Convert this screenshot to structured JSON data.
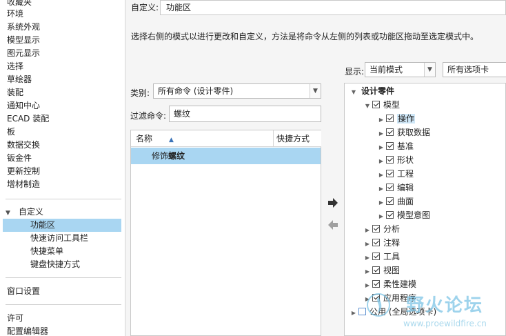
{
  "left_nav": {
    "items": [
      "收藏夹",
      "环境",
      "系统外观",
      "模型显示",
      "图元显示",
      "选择",
      "草绘器",
      "装配",
      "通知中心",
      "ECAD 装配",
      "板",
      "数据交换",
      "钣金件",
      "更新控制",
      "增材制造"
    ],
    "custom_group": "自定义",
    "custom_items": [
      "功能区",
      "快速访问工具栏",
      "快捷菜单",
      "键盘快捷方式"
    ],
    "window_settings": "窗口设置",
    "tail_items": [
      "许可",
      "配置编辑器"
    ]
  },
  "header": {
    "custom_label": "自定义:",
    "custom_value": "功能区",
    "instruction": "选择右侧的模式以进行更改和自定义，方法是将命令从左侧的列表或功能区拖动至选定模式中。"
  },
  "filters": {
    "display_label": "显示:",
    "display_value": "当前模式",
    "tabs_value": "所有选项卡",
    "category_label": "类别:",
    "category_value": "所有命令 (设计零件)",
    "filter_label": "过滤命令:",
    "filter_value": "螺纹"
  },
  "command_list": {
    "col_name": "名称",
    "col_shortcut": "快捷方式",
    "rows": [
      {
        "prefix": "修饰",
        "match": "螺纹"
      }
    ]
  },
  "tree": {
    "root": "设计零件",
    "model": "模型",
    "model_children": [
      "操作",
      "获取数据",
      "基准",
      "形状",
      "工程",
      "编辑",
      "曲面",
      "模型意图"
    ],
    "siblings": [
      "分析",
      "注释",
      "工具",
      "视图",
      "柔性建模",
      "应用程序"
    ],
    "common": "公用 (全局选项卡)"
  },
  "watermark": {
    "title": "野火论坛",
    "url": "www.proewildfire.cn"
  },
  "icons": {
    "add_arrow": "arrow-right-icon",
    "remove_arrow": "arrow-left-icon"
  },
  "colors": {
    "selection": "#a9d6f2",
    "watermark": "#7ec5e6"
  }
}
